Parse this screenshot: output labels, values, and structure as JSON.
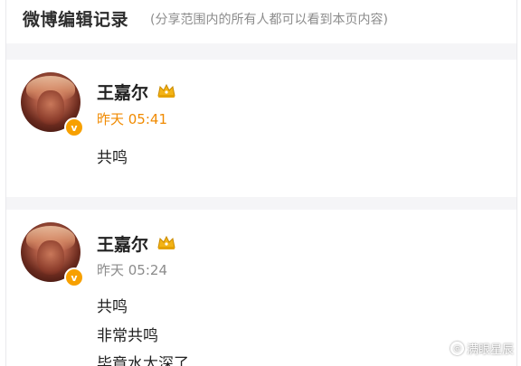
{
  "header": {
    "title": "微博编辑记录",
    "subtitle": "(分享范围内的所有人都可以看到本页内容)"
  },
  "records": [
    {
      "user": "王嘉尔",
      "time": "昨天 05:41",
      "time_color": "#f08a00",
      "lines": [
        "共鸣"
      ]
    },
    {
      "user": "王嘉尔",
      "time": "昨天 05:24",
      "time_color": "#8c8c8c",
      "lines": [
        "共鸣",
        "非常共鸣",
        "毕竟水太深了"
      ]
    }
  ],
  "badge": {
    "letter": "v",
    "color": "#f7a000"
  },
  "watermark": {
    "symbol": "@",
    "text": "满眼星辰"
  },
  "icons": {
    "crown": "crown-icon",
    "verified": "verified-badge-icon",
    "at": "at-icon"
  }
}
